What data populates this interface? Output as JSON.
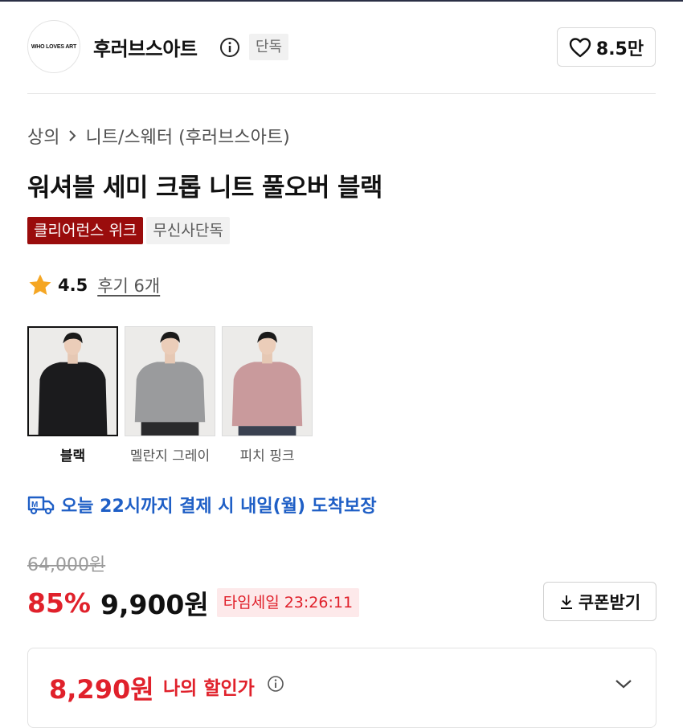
{
  "brand": {
    "logo_text": "WHO LOVES ART",
    "name": "후러브스아트",
    "badge": "단독",
    "likes": "8.5만"
  },
  "breadcrumb": {
    "category": "상의",
    "subcategory": "니트/스웨터 (후러브스아트)"
  },
  "product": {
    "title": "워셔블 세미 크롭 니트 풀오버 블랙",
    "tags": [
      "클리어런스 위크",
      "무신사단독"
    ],
    "rating": "4.5",
    "review_link": "후기 6개"
  },
  "colors": [
    {
      "label": "블랙",
      "selected": true,
      "swatch": "#1b1b1d"
    },
    {
      "label": "멜란지 그레이",
      "selected": false,
      "swatch": "#9a9b9d"
    },
    {
      "label": "피치 핑크",
      "selected": false,
      "swatch": "#c99a9c"
    }
  ],
  "delivery": {
    "text": "오늘 22시까지 결제 시 내일(월) 도착보장",
    "color": "#1f5fc6"
  },
  "price": {
    "original": "64,000원",
    "discount_rate": "85%",
    "sale": "9,900원",
    "time_sale": "타임세일 23:26:11",
    "coupon_label": "쿠폰받기",
    "accent_color": "#e0212b"
  },
  "my_price": {
    "value": "8,290원",
    "label": "나의 할인가"
  }
}
